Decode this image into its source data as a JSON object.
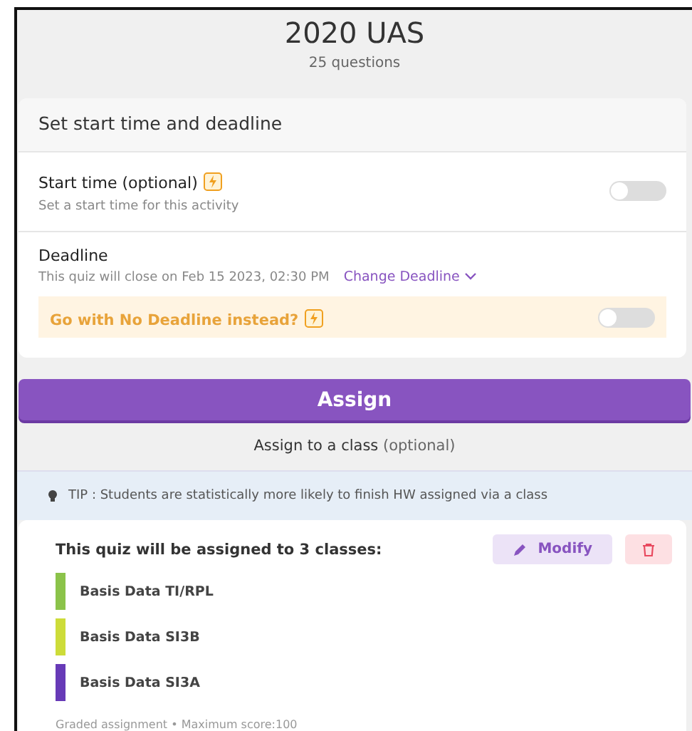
{
  "header": {
    "title": "2020 UAS",
    "subtitle": "25 questions"
  },
  "schedule": {
    "heading": "Set start time and deadline",
    "start_time": {
      "label": "Start time (optional)",
      "hint": "Set a start time for this activity",
      "on": false
    },
    "deadline": {
      "label": "Deadline",
      "text": "This quiz will close on Feb 15 2023, 02:30 PM",
      "link": "Change Deadline"
    },
    "no_deadline": {
      "label": "Go with No Deadline instead?",
      "on": false
    }
  },
  "assign_button": "Assign",
  "assign_class": {
    "label": "Assign to a class",
    "note": "(optional)"
  },
  "tip": "TIP : Students are statistically more likely to finish HW assigned via a class",
  "classes": {
    "heading": "This quiz will be assigned to 3 classes:",
    "modify": "Modify",
    "items": [
      {
        "name": "Basis Data TI/RPL",
        "color": "#8bc34a"
      },
      {
        "name": "Basis Data SI3B",
        "color": "#cddc39"
      },
      {
        "name": "Basis Data SI3A",
        "color": "#673ab7"
      }
    ],
    "footer": "Graded assignment • Maximum score:100"
  }
}
